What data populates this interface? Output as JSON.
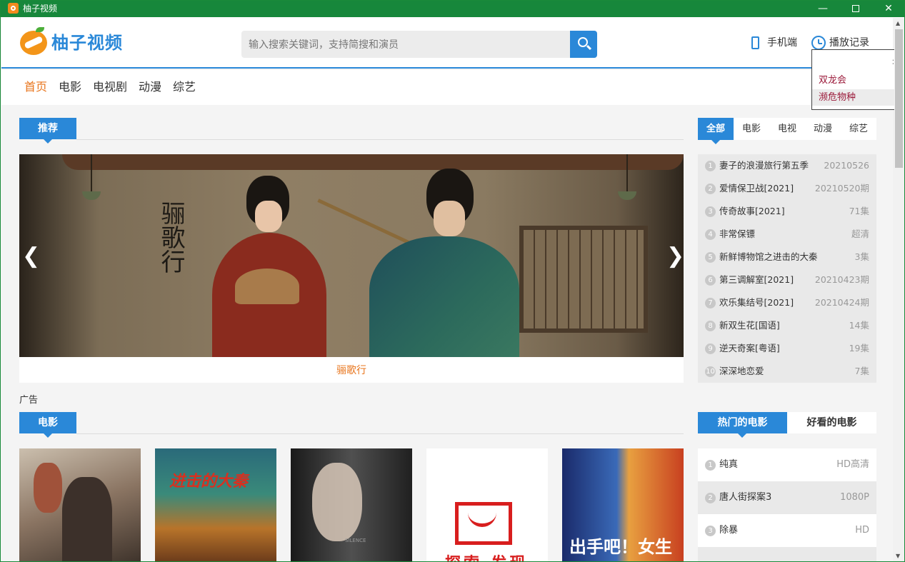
{
  "window": {
    "title": "柚子视频"
  },
  "header": {
    "brand": "柚子视频",
    "search_placeholder": "输入搜索关键词，支持简搜和演员",
    "mobile_label": "手机端",
    "history_label": "播放记录"
  },
  "history": {
    "items": [
      "双龙会",
      "濒危物种"
    ]
  },
  "nav": {
    "items": [
      "首页",
      "电影",
      "电视剧",
      "动漫",
      "综艺"
    ],
    "active": "首页"
  },
  "recommend": {
    "section_title": "推荐",
    "hero_title": "骊歌行",
    "hero_calligraphy": "骊歌行"
  },
  "ad_label": "广告",
  "categories": {
    "tabs": [
      "全部",
      "电影",
      "电视",
      "动漫",
      "综艺"
    ],
    "active": "全部"
  },
  "rank_list": [
    {
      "num": "1",
      "title": "妻子的浪漫旅行第五季",
      "ep": "20210526"
    },
    {
      "num": "2",
      "title": "爱情保卫战[2021]",
      "ep": "20210520期"
    },
    {
      "num": "3",
      "title": "传奇故事[2021]",
      "ep": "71集"
    },
    {
      "num": "4",
      "title": "非常保镖",
      "ep": "超清"
    },
    {
      "num": "5",
      "title": "新鲜博物馆之进击的大秦",
      "ep": "3集"
    },
    {
      "num": "6",
      "title": "第三调解室[2021]",
      "ep": "20210423期"
    },
    {
      "num": "7",
      "title": "欢乐集结号[2021]",
      "ep": "20210424期"
    },
    {
      "num": "8",
      "title": "新双生花[国语]",
      "ep": "14集"
    },
    {
      "num": "9",
      "title": "逆天奇案[粤语]",
      "ep": "19集"
    },
    {
      "num": "10",
      "title": "深深地恋爱",
      "ep": "7集"
    }
  ],
  "movie_section": {
    "title": "电影",
    "tabs": [
      "热门的电影",
      "好看的电影"
    ],
    "active": "热门的电影",
    "rank": [
      {
        "num": "1",
        "title": "纯真",
        "ep": "HD高清"
      },
      {
        "num": "2",
        "title": "唐人街探案3",
        "ep": "1080P"
      },
      {
        "num": "3",
        "title": "除暴",
        "ep": "HD"
      }
    ],
    "posters": [
      {
        "title": ""
      },
      {
        "title": "进击的大秦"
      },
      {
        "title": "SILENCE"
      },
      {
        "title": "探索·发现"
      },
      {
        "title": "出手吧！女生"
      }
    ]
  },
  "colors": {
    "accent": "#2a88d8",
    "active_nav": "#e8741b",
    "titlebar": "#17873b",
    "history_text": "#9b1a3a"
  }
}
